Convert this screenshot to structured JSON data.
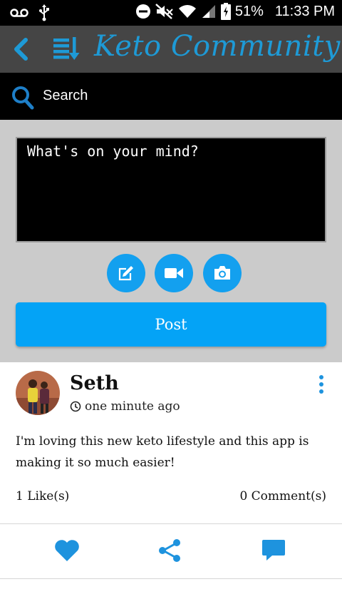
{
  "status_bar": {
    "battery": "51%",
    "time": "11:33 PM"
  },
  "header": {
    "title": "Keto Community"
  },
  "search": {
    "label": "Search"
  },
  "composer": {
    "placeholder": "What's on your mind?",
    "post_label": "Post"
  },
  "post": {
    "author": "Seth",
    "time": "one minute ago",
    "body": "I'm loving this new keto lifestyle and this app is making it so much easier!",
    "likes": "1 Like(s)",
    "comments": "0 Comment(s)"
  },
  "colors": {
    "accent": "#04a3f6",
    "title": "#1e9ad6",
    "header_bg": "#454545",
    "composer_bg": "#cbcbcb"
  },
  "icons": [
    "voicemail-icon",
    "usb-icon",
    "do-not-disturb-icon",
    "mute-icon",
    "wifi-icon",
    "signal-icon",
    "battery-icon",
    "back-icon",
    "sort-icon",
    "search-icon",
    "edit-icon",
    "video-icon",
    "camera-icon",
    "clock-icon",
    "more-icon",
    "heart-icon",
    "share-icon",
    "comment-icon"
  ]
}
